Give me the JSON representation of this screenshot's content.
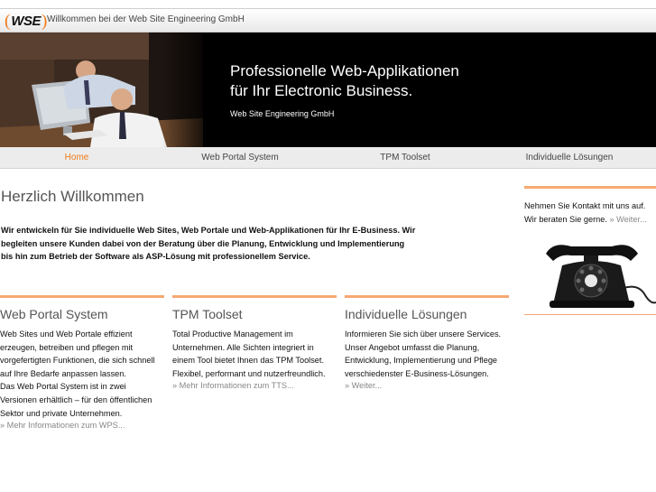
{
  "header": {
    "logo_text": "WSE",
    "title": "Willkommen bei der Web Site Engineering GmbH"
  },
  "hero": {
    "headline_1": "Professionelle Web-Applikationen",
    "headline_2": "für Ihr Electronic Business.",
    "company": "Web Site Engineering GmbH"
  },
  "nav": {
    "items": [
      {
        "label": "Home",
        "active": true
      },
      {
        "label": "Web Portal System"
      },
      {
        "label": "TPM Toolset"
      },
      {
        "label": "Individuelle Lösungen"
      }
    ]
  },
  "main": {
    "title": "Herzlich Willkommen",
    "intro": "Wir entwickeln für Sie individuelle Web Sites, Web Portale und Web-Applikationen für Ihr E-Business. Wir begleiten unsere Kunden dabei von der Beratung über die Planung, Entwicklung und Implementierung bis hin zum Betrieb der Software als ASP-Lösung mit professionellem Service.",
    "columns": [
      {
        "title": "Web Portal System",
        "text_1": "Web Sites und Web Portale effizient erzeugen, betreiben und pflegen mit vorgefertigten Funktionen, die sich schnell auf Ihre Bedarfe anpassen lassen.",
        "text_2": "Das Web Portal System ist in zwei Versionen erhältlich – für den öffentlichen Sektor und private Unternehmen.",
        "more": "» Mehr Informationen zum WPS..."
      },
      {
        "title": "TPM Toolset",
        "text_1": "Total Productive Management im Unternehmen. Alle Sichten integriert in einem Tool bietet Ihnen das TPM Toolset. Flexibel, performant und nutzerfreundlich.",
        "more": "» Mehr Informationen zum TTS..."
      },
      {
        "title": "Individuelle Lösungen",
        "text_1": "Informieren Sie sich über unsere Services. Unser Angebot umfasst die Planung, Entwicklung, Implementierung und Pflege verschiedenster E-Business-Lösungen.",
        "more": "» Weiter..."
      }
    ]
  },
  "sidebar": {
    "text_1": "Nehmen Sie Kontakt mit uns auf.",
    "text_2": "Wir beraten Sie gerne.",
    "more": "» Weiter..."
  },
  "colors": {
    "accent": "#f07a1a",
    "accent_line": "#f6a873",
    "hero_bg": "#000000"
  }
}
